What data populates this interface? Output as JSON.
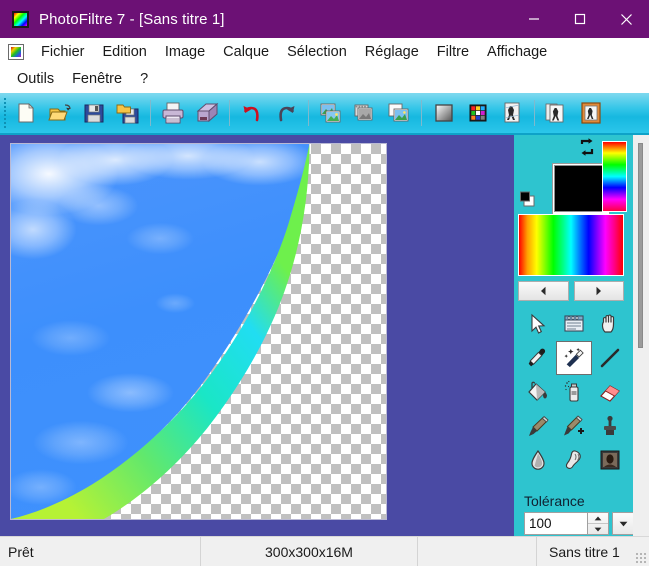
{
  "window": {
    "title": "PhotoFiltre 7 - [Sans titre 1]",
    "app_icon": "photofiltre-rainbow-icon",
    "titlebar_color": "#6c1175",
    "controls": {
      "minimize": "minimize-icon",
      "maximize": "maximize-icon",
      "close": "close-icon"
    }
  },
  "menubar": {
    "doc_icon": "document-icon",
    "items": [
      {
        "label": "Fichier"
      },
      {
        "label": "Edition"
      },
      {
        "label": "Image"
      },
      {
        "label": "Calque"
      },
      {
        "label": "Sélection"
      },
      {
        "label": "Réglage"
      },
      {
        "label": "Filtre"
      },
      {
        "label": "Affichage"
      },
      {
        "label": "Outils"
      },
      {
        "label": "Fenêtre"
      },
      {
        "label": "?"
      }
    ],
    "mdi_controls": {
      "minimize": "mdi-minimize-icon",
      "restore": "mdi-restore-icon",
      "close": "mdi-close-icon"
    }
  },
  "toolbar": {
    "background_color": "#2cc6ea",
    "buttons": [
      {
        "name": "new-document-icon",
        "group": 1
      },
      {
        "name": "open-folder-icon",
        "group": 1
      },
      {
        "name": "save-icon",
        "group": 1
      },
      {
        "name": "save-as-icon",
        "group": 1
      },
      {
        "name": "print-icon",
        "group": 2
      },
      {
        "name": "scanner-acquire-icon",
        "group": 2
      },
      {
        "name": "undo-icon",
        "group": 3
      },
      {
        "name": "redo-icon",
        "group": 3
      },
      {
        "name": "copy-image-icon",
        "group": 4
      },
      {
        "name": "paste-grayscale-icon",
        "group": 4
      },
      {
        "name": "duplicate-image-icon",
        "group": 4
      },
      {
        "name": "gradient-icon",
        "group": 5
      },
      {
        "name": "color-palette-icon",
        "group": 5
      },
      {
        "name": "image-effect-icon",
        "group": 5
      },
      {
        "name": "batch-images-icon",
        "group": 6
      },
      {
        "name": "framed-image-icon",
        "group": 6
      }
    ]
  },
  "workspace": {
    "background_color": "#4a4aa4",
    "canvas": {
      "label": "image-canvas",
      "transparency_checkerboard": true,
      "sky_color": "#3d8ffc",
      "gradient_colors": [
        "#a8f03c",
        "#5ae06a",
        "#18e8c8",
        "#22e0ff"
      ]
    }
  },
  "right_panel": {
    "background_color": "#2ec4cf",
    "colors": {
      "foreground": "#000000",
      "background": "#ffffff",
      "swap_icon": "swap-colors-icon",
      "default_icon": "default-colors-icon",
      "hue_strip": "hue-strip",
      "gradient_palette": "gradient-palette",
      "prev_label": "◀",
      "next_label": "▶"
    },
    "tools": [
      {
        "name": "selection-arrow-tool",
        "selected": false
      },
      {
        "name": "selection-options-tool",
        "selected": false
      },
      {
        "name": "hand-tool",
        "selected": false
      },
      {
        "name": "eyedropper-tool",
        "selected": false
      },
      {
        "name": "magic-wand-tool",
        "selected": true
      },
      {
        "name": "line-tool",
        "selected": false
      },
      {
        "name": "paint-bucket-tool",
        "selected": false
      },
      {
        "name": "spray-can-tool",
        "selected": false
      },
      {
        "name": "eraser-tool",
        "selected": false
      },
      {
        "name": "paintbrush-tool",
        "selected": false
      },
      {
        "name": "paintbrush-plus-tool",
        "selected": false
      },
      {
        "name": "clone-stamp-tool",
        "selected": false
      },
      {
        "name": "blur-drop-tool",
        "selected": false
      },
      {
        "name": "smudge-tool",
        "selected": false
      },
      {
        "name": "red-eye-photo-tool",
        "selected": false
      }
    ],
    "tolerance": {
      "label": "Tolérance",
      "value": "100",
      "spin_up": "▲",
      "spin_down": "▼",
      "dropdown": "▼"
    }
  },
  "statusbar": {
    "ready_text": "Prêt",
    "image_info": "300x300x16M",
    "extra": "",
    "document_name": "Sans titre 1"
  }
}
